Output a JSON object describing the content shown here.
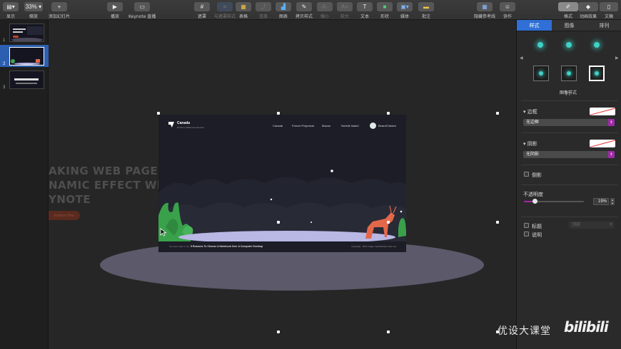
{
  "toolbar": {
    "view_label": "显示",
    "zoom_value": "33%",
    "zoom_label": "缩放",
    "add_slide_label": "添加幻灯片",
    "play_label": "播放",
    "keynote_live_label": "Keynote 直播",
    "mask_label": "遮罩",
    "style_mask_label": "与遮罩样式",
    "table_label": "表格",
    "link_label": "连接",
    "chart_label": "图表",
    "copy_style_label": "拷贝样式",
    "shrink_label": "缩小",
    "enlarge_label": "较大",
    "text_label": "文本",
    "shape_label": "形状",
    "media_label": "媒体",
    "comment_label": "批注",
    "hide_guides_label": "隐藏参考线",
    "collaborate_label": "协作",
    "format_label": "格式",
    "animate_label": "动画效果",
    "document_label": "文稿",
    "play_glyph": "▶",
    "add_glyph": "+",
    "text_glyph": "T"
  },
  "navigator": {
    "slides": [
      {
        "number": "1"
      },
      {
        "number": "2",
        "selected": true
      },
      {
        "number": "3"
      }
    ]
  },
  "canvas": {
    "background_lines": [
      "AKING WEB PAGE",
      "NAMIC EFFECT WITH",
      "YNOTE"
    ],
    "background_button": "Explore Now"
  },
  "slide": {
    "brand": "Canada",
    "brand_sub": "Northern Wilderness Reveal",
    "nav_links": [
      "Canada",
      "French Polynesia",
      "Macao",
      "Norfolk Island"
    ],
    "user_name": "BeardChicken",
    "footer_left": "Sunspots data on the",
    "footer_center": "5 Reasons To Choose A Notebook Over A Computer Desktop",
    "footer_right": "Copyright · 2021 image: beardchicken.sites.net"
  },
  "inspector": {
    "tabs": [
      {
        "label": "样式",
        "active": true
      },
      {
        "label": "图像"
      },
      {
        "label": "排列"
      }
    ],
    "image_style_label": "图像样式",
    "border_label": "边框",
    "border_value": "无边框",
    "shadow_label": "阴影",
    "shadow_value": "无阴影",
    "reflection_label": "倒影",
    "opacity_label": "不透明度",
    "opacity_value": "19%",
    "opacity_fraction": 0.19,
    "title_label": "标题",
    "title_select": "顶部",
    "caption_label": "说明",
    "accent_color": "#a02aa8",
    "tab_active_color": "#2f6fd6"
  },
  "watermark": {
    "text": "优设大课堂",
    "logo": "bilibili"
  }
}
